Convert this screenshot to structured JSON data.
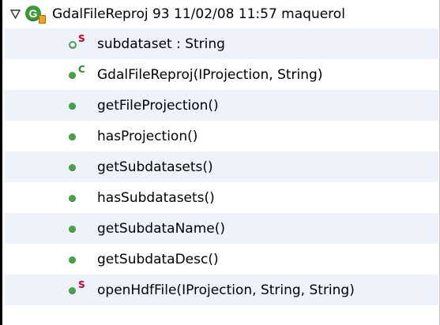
{
  "tree": {
    "class_node": {
      "label": "GdalFileReproj 93  11/02/08 11:57  maquerol",
      "icon_letter": "G",
      "expanded": true
    },
    "members": [
      {
        "label": "subdataset : String",
        "icon": "field-private-icon",
        "overlay": "S"
      },
      {
        "label": "GdalFileReproj(IProjection, String)",
        "icon": "method-public-icon",
        "overlay": "C"
      },
      {
        "label": "getFileProjection()",
        "icon": "method-public-icon",
        "overlay": ""
      },
      {
        "label": "hasProjection()",
        "icon": "method-public-icon",
        "overlay": ""
      },
      {
        "label": "getSubdatasets()",
        "icon": "method-public-icon",
        "overlay": ""
      },
      {
        "label": "hasSubdatasets()",
        "icon": "method-public-icon",
        "overlay": ""
      },
      {
        "label": "getSubdataName()",
        "icon": "method-public-icon",
        "overlay": ""
      },
      {
        "label": "getSubdataDesc()",
        "icon": "method-public-icon",
        "overlay": ""
      },
      {
        "label": "openHdfFile(IProjection, String, String)",
        "icon": "method-public-icon",
        "overlay": "S"
      }
    ]
  },
  "colors": {
    "method_green": "#43a545",
    "static_marker": "#c0002a",
    "constructor_marker": "#2a8a2a",
    "row_alt_bg": "#eef3fb"
  }
}
